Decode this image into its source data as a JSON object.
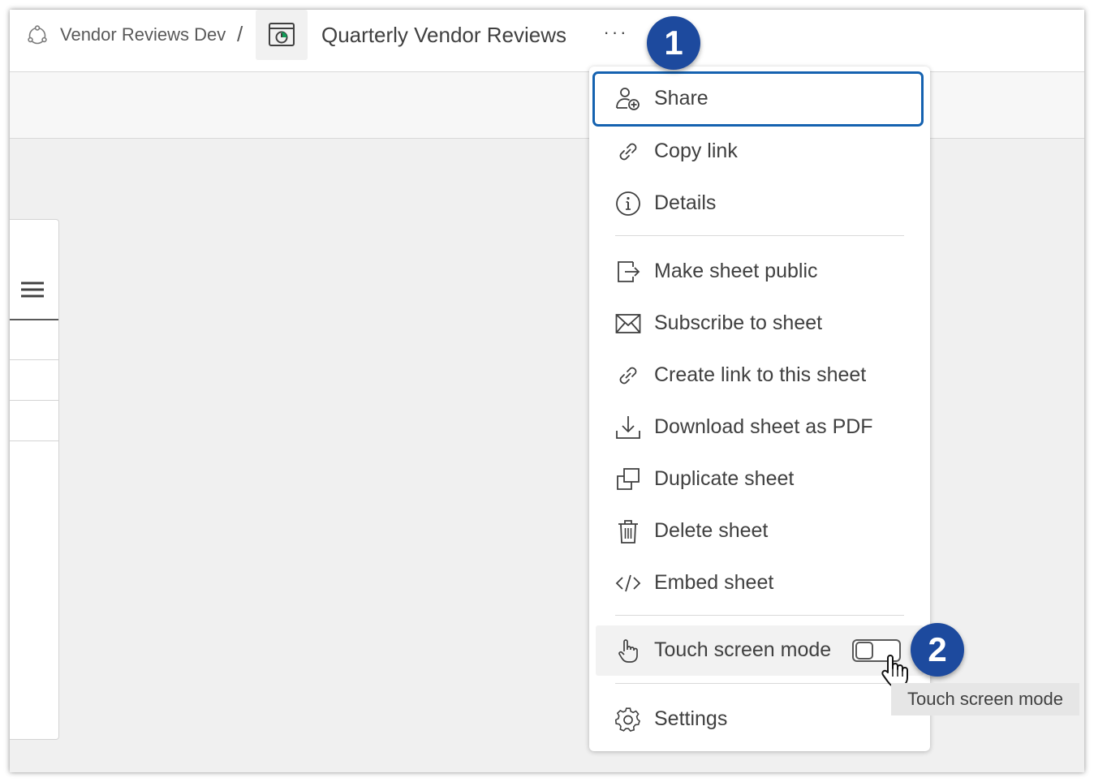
{
  "breadcrumb": {
    "space_name": "Vendor Reviews Dev",
    "separator": "/",
    "space_icon": "space-icon",
    "sheet_icon": "sheet-icon"
  },
  "header": {
    "sheet_title": "Quarterly Vendor Reviews",
    "more_label": "···"
  },
  "left_panel": {
    "menu_icon": "hamburger-icon"
  },
  "menu": {
    "items": [
      {
        "label": "Share",
        "icon": "share-user-plus-icon"
      },
      {
        "label": "Copy link",
        "icon": "link-icon"
      },
      {
        "label": "Details",
        "icon": "info-icon"
      },
      {
        "label": "Make sheet public",
        "icon": "publish-icon"
      },
      {
        "label": "Subscribe to sheet",
        "icon": "envelope-icon"
      },
      {
        "label": "Create link to this sheet",
        "icon": "link-icon"
      },
      {
        "label": "Download sheet as PDF",
        "icon": "download-icon"
      },
      {
        "label": "Duplicate sheet",
        "icon": "duplicate-icon"
      },
      {
        "label": "Delete sheet",
        "icon": "trash-icon"
      },
      {
        "label": "Embed sheet",
        "icon": "code-icon"
      },
      {
        "label": "Touch screen mode",
        "icon": "touch-hand-icon",
        "toggle_on": false
      },
      {
        "label": "Settings",
        "icon": "gear-icon"
      }
    ]
  },
  "annotations": {
    "badge_1": "1",
    "badge_2": "2"
  },
  "tooltip": {
    "text": "Touch screen mode"
  },
  "colors": {
    "focus_outline": "#1562b0",
    "badge_fill": "#1d4a9e",
    "accent_green": "#0f9d58"
  }
}
